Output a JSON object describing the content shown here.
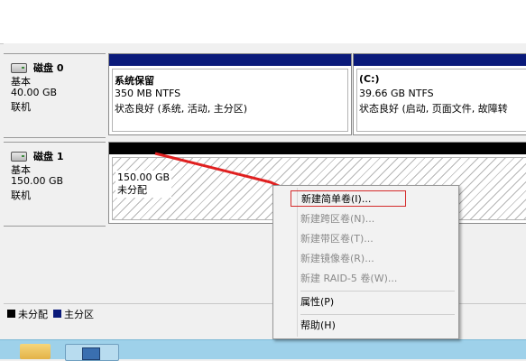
{
  "disks": [
    {
      "name": "磁盘 0",
      "type": "基本",
      "size": "40.00 GB",
      "status": "联机"
    },
    {
      "name": "磁盘 1",
      "type": "基本",
      "size": "150.00 GB",
      "status": "联机"
    }
  ],
  "partitions": {
    "system_reserved": {
      "name": "系统保留",
      "size_fs": "350 MB NTFS",
      "status": "状态良好 (系统, 活动, 主分区)"
    },
    "c_drive": {
      "name": "(C:)",
      "size_fs": "39.66 GB NTFS",
      "status": "状态良好 (启动, 页面文件, 故障转"
    },
    "unallocated": {
      "size": "150.00 GB",
      "status": "未分配"
    }
  },
  "legend": [
    {
      "label": "未分配",
      "color": "#000000"
    },
    {
      "label": "主分区",
      "color": "#0a1a7a"
    }
  ],
  "context_menu": {
    "items": [
      {
        "label": "新建简单卷(I)...",
        "enabled": true,
        "highlighted": true
      },
      {
        "label": "新建跨区卷(N)...",
        "enabled": false
      },
      {
        "label": "新建带区卷(T)...",
        "enabled": false
      },
      {
        "label": "新建镜像卷(R)...",
        "enabled": false
      },
      {
        "label": "新建 RAID-5 卷(W)...",
        "enabled": false
      },
      {
        "label": "属性(P)",
        "enabled": true
      },
      {
        "label": "帮助(H)",
        "enabled": true
      }
    ]
  },
  "colors": {
    "primary_partition": "#0a1a7a",
    "unallocated": "#000000",
    "annotation_red": "#e02020",
    "taskbar": "#9ed1ea"
  }
}
